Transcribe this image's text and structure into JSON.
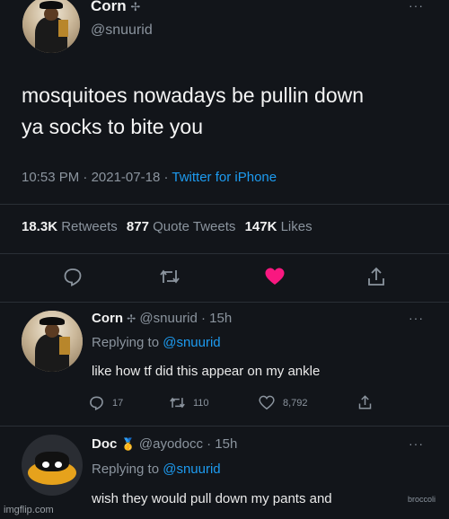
{
  "main_tweet": {
    "display_name": "Corn",
    "name_badge": "✢",
    "handle": "@snuurid",
    "text_line1": "mosquitoes nowadays be pullin down",
    "text_line2": "ya socks to bite you",
    "time": "10:53 PM",
    "date": "2021-07-18",
    "separator": "·",
    "source": "Twitter for iPhone",
    "stats": {
      "retweets_count": "18.3K",
      "retweets_label": "Retweets",
      "quotes_count": "877",
      "quotes_label": "Quote Tweets",
      "likes_count": "147K",
      "likes_label": "Likes"
    },
    "more": "···"
  },
  "replies": [
    {
      "display_name": "Corn",
      "name_badge": "✢",
      "handle_time": "@snuurid · 15h",
      "replying_prefix": "Replying to",
      "replying_to": "@snuurid",
      "text": "like how tf did this appear on my ankle",
      "reply_count": "17",
      "retweet_count": "110",
      "like_count": "8,792",
      "more": "···"
    },
    {
      "display_name": "Doc",
      "name_badge": "🥇",
      "handle_time": "@ayodocc · 15h",
      "replying_prefix": "Replying to",
      "replying_to": "@snuurid",
      "text": "wish they would pull down my pants and",
      "more": "···"
    }
  ],
  "watermarks": {
    "site": "imgflip.com",
    "credit": "broccoli"
  },
  "colors": {
    "background": "#12151a",
    "accent": "#1d9bf0",
    "like": "#f91880",
    "muted": "#8b949e"
  }
}
